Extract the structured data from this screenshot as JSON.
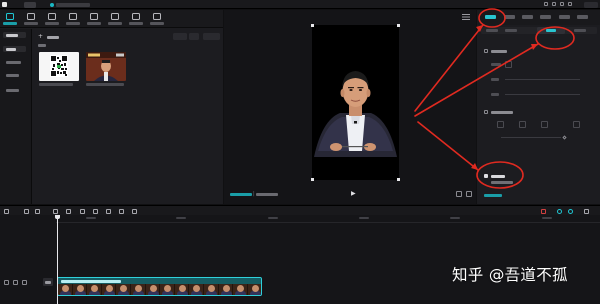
{
  "topbar": {
    "window_title": "",
    "app_name": "",
    "export_label": ""
  },
  "media": {
    "tool_tabs": [
      "",
      "",
      "",
      "",
      "",
      "",
      "",
      ""
    ],
    "side_nav": [
      "",
      "",
      "",
      "",
      ""
    ],
    "import_label": "",
    "section_label": ""
  },
  "preview": {
    "status_text": "",
    "time_current": "",
    "time_total": ""
  },
  "props": {
    "tabs": [
      "",
      "",
      "",
      "",
      "",
      ""
    ],
    "subtabs": [
      "",
      "",
      "",
      ""
    ],
    "options": [
      "",
      "",
      ""
    ]
  },
  "timeline": {
    "clip_name": "",
    "cover_label": ""
  },
  "watermark": {
    "text": "知乎 @吾道不孤"
  },
  "colors": {
    "accent": "#1fc7d4",
    "annotation": "#e02a20",
    "background": "#101012",
    "panel": "#1c1c20"
  }
}
